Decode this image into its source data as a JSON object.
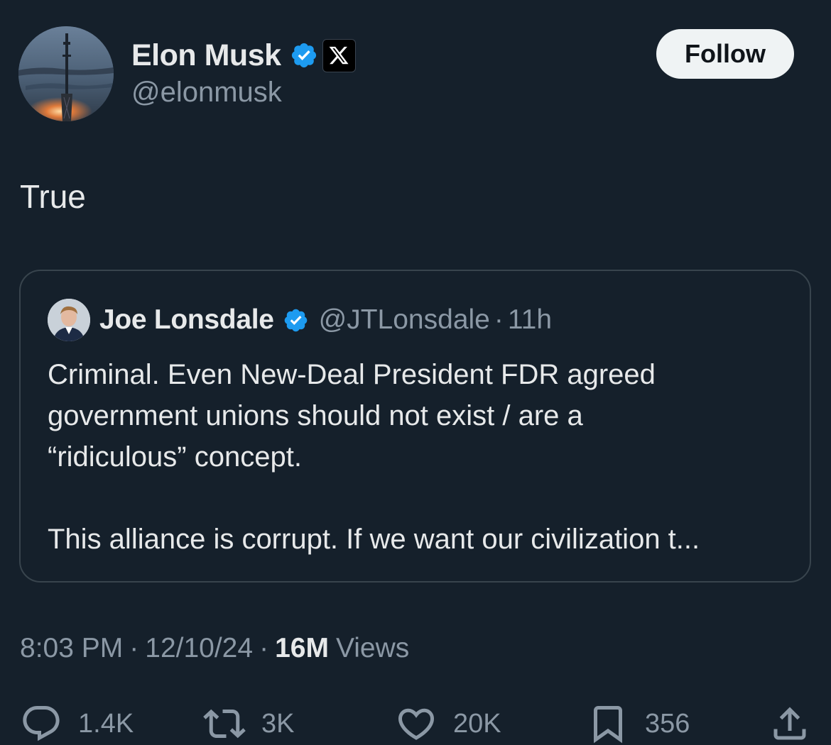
{
  "tweet": {
    "author": {
      "name": "Elon Musk",
      "handle": "@elonmusk",
      "verified": true,
      "affiliation_icon": "x-logo-icon"
    },
    "follow_label": "Follow",
    "text": "True",
    "quoted": {
      "author": {
        "name": "Joe Lonsdale",
        "handle": "@JTLonsdale",
        "verified": true
      },
      "separator": "·",
      "time": "11h",
      "paragraphs": [
        "Criminal. Even New-Deal President FDR agreed",
        "government unions should not exist / are a",
        "“ridiculous” concept.",
        "This alliance is corrupt. If we want our civilization t..."
      ]
    },
    "meta": {
      "time": "8:03 PM",
      "separator": "·",
      "date": "12/10/24",
      "views_count": "16M",
      "views_label": "Views"
    },
    "actions": {
      "replies": "1.4K",
      "reposts": "3K",
      "likes": "20K",
      "bookmarks": "356"
    }
  },
  "colors": {
    "background": "#15202b",
    "primary_text": "#e7e9ea",
    "secondary_text": "#8b98a5",
    "border": "#38444d",
    "verified_blue": "#1d9bf0",
    "follow_button_bg": "#eff3f4"
  }
}
